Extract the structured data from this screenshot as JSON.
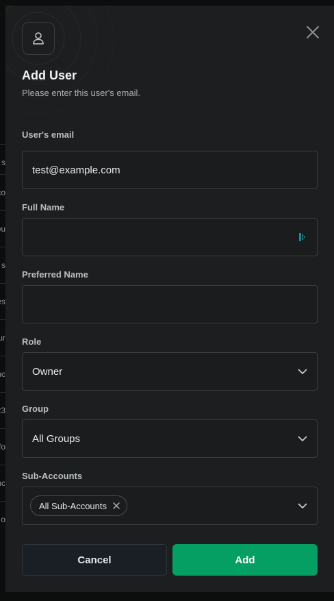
{
  "background_rows": [
    "s",
    "co",
    "ou",
    "s",
    "es",
    "ur",
    "nc",
    "23",
    "fo",
    "nc",
    "o"
  ],
  "modal": {
    "title": "Add User",
    "subtitle": "Please enter this user's email.",
    "header_icon": "user-icon",
    "close_icon": "close-icon"
  },
  "form": {
    "email": {
      "label": "User's email",
      "value": "test@example.com"
    },
    "full_name": {
      "label": "Full Name",
      "value": ""
    },
    "preferred_name": {
      "label": "Preferred Name",
      "value": ""
    },
    "role": {
      "label": "Role",
      "value": "Owner"
    },
    "group": {
      "label": "Group",
      "value": "All Groups"
    },
    "sub_accounts": {
      "label": "Sub-Accounts",
      "chips": [
        "All Sub-Accounts"
      ]
    }
  },
  "actions": {
    "cancel_label": "Cancel",
    "add_label": "Add"
  },
  "colors": {
    "accent": "#059e63",
    "modal_bg": "#1c1e1f",
    "border": "#3b3f41"
  }
}
